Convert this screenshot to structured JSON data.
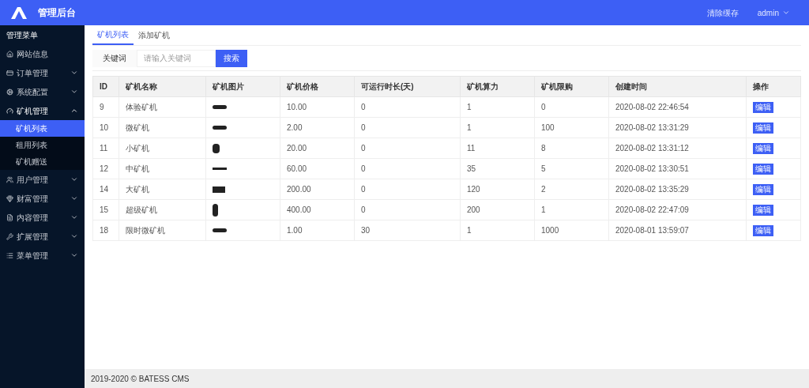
{
  "header": {
    "title": "管理后台",
    "actions": [
      {
        "kind": "link",
        "label": "清除缓存"
      },
      {
        "kind": "menu",
        "label": "admin"
      }
    ]
  },
  "sidebar": {
    "title": "管理菜单",
    "items": [
      {
        "label": "网站信息",
        "selected": false
      },
      {
        "label": "订单管理",
        "expanded": false,
        "selected": false
      },
      {
        "label": "系统配置",
        "expanded": false,
        "selected": false
      },
      {
        "label": "矿机管理",
        "expanded": true,
        "selected": false,
        "children": [
          {
            "label": "矿机列表",
            "selected": true
          },
          {
            "label": "租用列表",
            "selected": false
          },
          {
            "label": "矿机赠送",
            "selected": false
          }
        ]
      },
      {
        "label": "用户管理",
        "expanded": false,
        "selected": false
      },
      {
        "label": "财富管理",
        "expanded": false,
        "selected": false
      },
      {
        "label": "内容管理",
        "expanded": false,
        "selected": false
      },
      {
        "label": "扩展管理",
        "expanded": false,
        "selected": false
      },
      {
        "label": "菜单管理",
        "expanded": false,
        "selected": false
      }
    ]
  },
  "tabs": [
    {
      "label": "矿机列表",
      "selected": true
    },
    {
      "label": "添加矿机",
      "selected": false
    }
  ],
  "search": {
    "label": "关键词",
    "placeholder": "请输入关键词",
    "button": "搜索"
  },
  "table": {
    "columns": [
      "ID",
      "矿机名称",
      "矿机图片",
      "矿机价格",
      "可运行时长(天)",
      "矿机算力",
      "矿机限购",
      "创建时间",
      "操作"
    ],
    "rows": [
      {
        "id": "9",
        "name": "体验矿机",
        "price": "10.00",
        "days": "0",
        "power": "1",
        "limit": "0",
        "created": "2020-08-02 22:46:54",
        "action": "编辑"
      },
      {
        "id": "10",
        "name": "微矿机",
        "price": "2.00",
        "days": "0",
        "power": "1",
        "limit": "100",
        "created": "2020-08-02 13:31:29",
        "action": "编辑"
      },
      {
        "id": "11",
        "name": "小矿机",
        "price": "20.00",
        "days": "0",
        "power": "11",
        "limit": "8",
        "created": "2020-08-02 13:31:12",
        "action": "编辑"
      },
      {
        "id": "12",
        "name": "中矿机",
        "price": "60.00",
        "days": "0",
        "power": "35",
        "limit": "5",
        "created": "2020-08-02 13:30:51",
        "action": "编辑"
      },
      {
        "id": "14",
        "name": "大矿机",
        "price": "200.00",
        "days": "0",
        "power": "120",
        "limit": "2",
        "created": "2020-08-02 13:35:29",
        "action": "编辑"
      },
      {
        "id": "15",
        "name": "超级矿机",
        "price": "400.00",
        "days": "0",
        "power": "200",
        "limit": "1",
        "created": "2020-08-02 22:47:09",
        "action": "编辑"
      },
      {
        "id": "18",
        "name": "限时微矿机",
        "price": "1.00",
        "days": "30",
        "power": "1",
        "limit": "1000",
        "created": "2020-08-01 13:59:07",
        "action": "编辑"
      }
    ]
  },
  "footer": "2019-2020 © BATESS CMS"
}
